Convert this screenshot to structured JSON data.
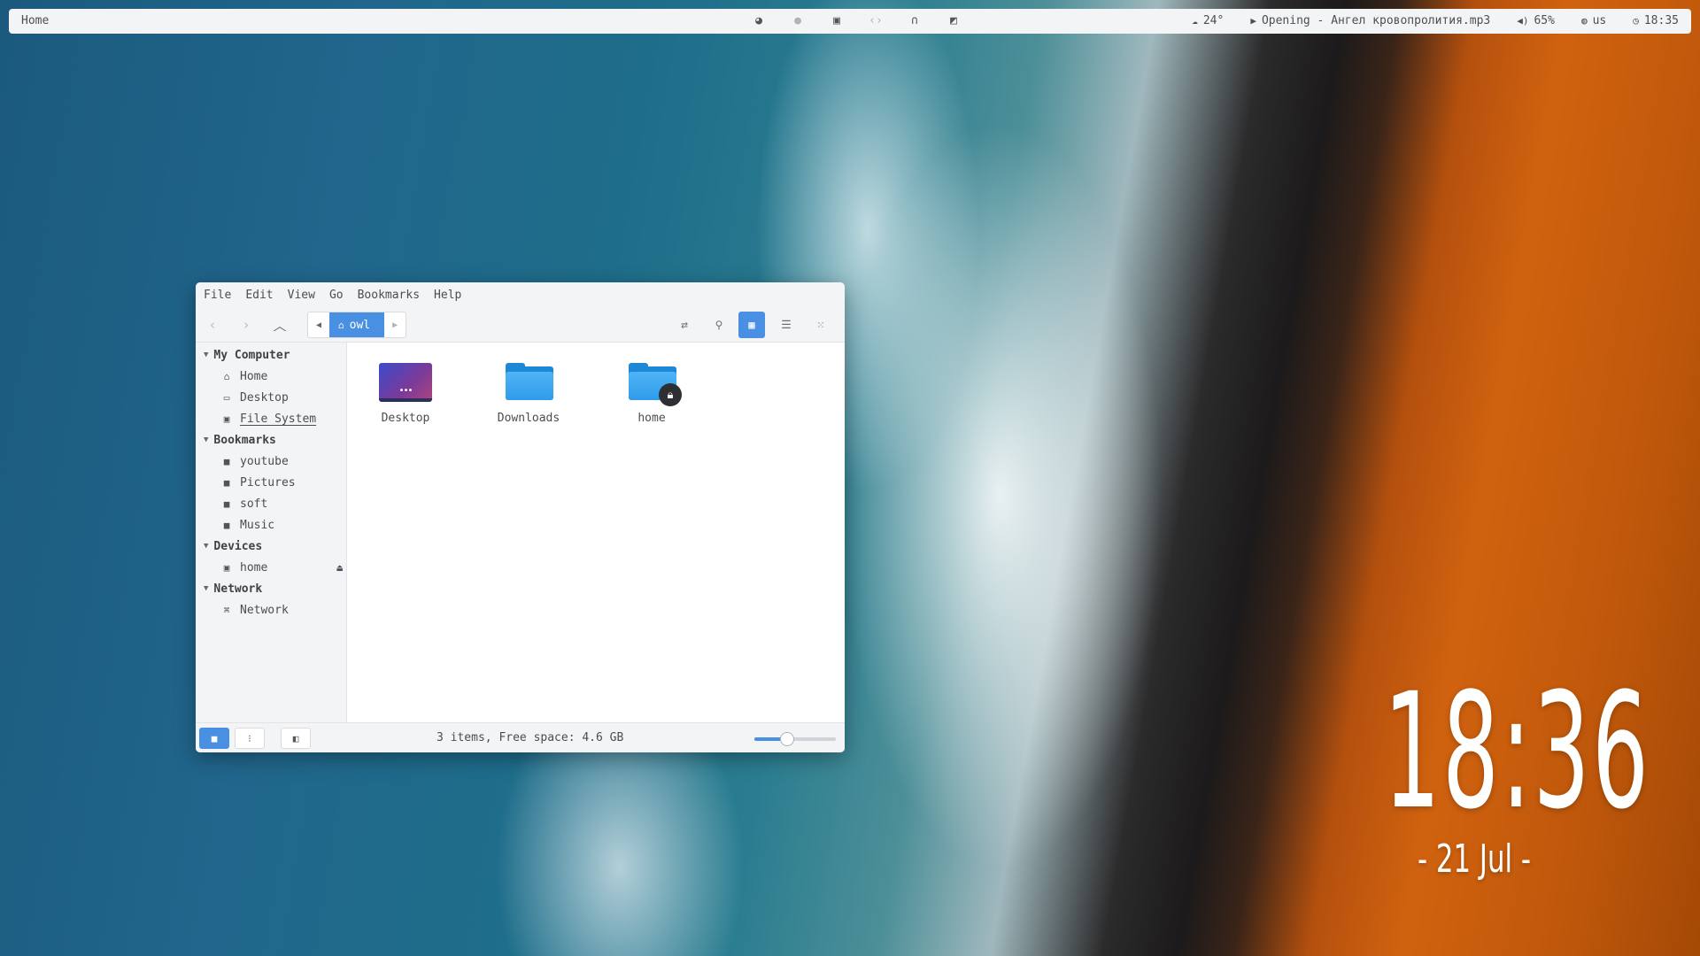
{
  "topbar": {
    "title": "Home",
    "tray_icons": [
      "firefox-icon",
      "app-icon",
      "linkedin-icon",
      "code-icon",
      "headphones-icon",
      "terminal-icon"
    ],
    "weather": "24°",
    "media": "Opening - Ангел кровопролития.mp3",
    "volume": "65%",
    "keyboard": "us",
    "time": "18:35"
  },
  "window": {
    "menu": [
      "File",
      "Edit",
      "View",
      "Go",
      "Bookmarks",
      "Help"
    ],
    "path_button": "owl",
    "sidebar": {
      "sections": [
        {
          "title": "My Computer",
          "items": [
            {
              "label": "Home",
              "icon": "home-icon"
            },
            {
              "label": "Desktop",
              "icon": "monitor-icon"
            },
            {
              "label": "File System",
              "icon": "drive-icon"
            }
          ]
        },
        {
          "title": "Bookmarks",
          "items": [
            {
              "label": "youtube",
              "icon": "folder-icon"
            },
            {
              "label": "Pictures",
              "icon": "folder-icon"
            },
            {
              "label": "soft",
              "icon": "folder-icon"
            },
            {
              "label": "Music",
              "icon": "folder-icon"
            }
          ]
        },
        {
          "title": "Devices",
          "items": [
            {
              "label": "home",
              "icon": "drive-icon"
            }
          ]
        },
        {
          "title": "Network",
          "items": [
            {
              "label": "Network",
              "icon": "network-icon"
            }
          ]
        }
      ]
    },
    "files": [
      {
        "label": "Desktop",
        "icon": "desktop-folder-icon"
      },
      {
        "label": "Downloads",
        "icon": "folder-icon"
      },
      {
        "label": "home",
        "icon": "locked-folder-icon"
      }
    ],
    "status": "3 items, Free space: 4.6 GB",
    "zoom_level": 0.4
  },
  "desktop_clock": {
    "time": "18:36",
    "date": "-  21 Jul  -"
  },
  "colors": {
    "accent": "#4a90e2",
    "panel_bg": "#f3f4f6"
  }
}
